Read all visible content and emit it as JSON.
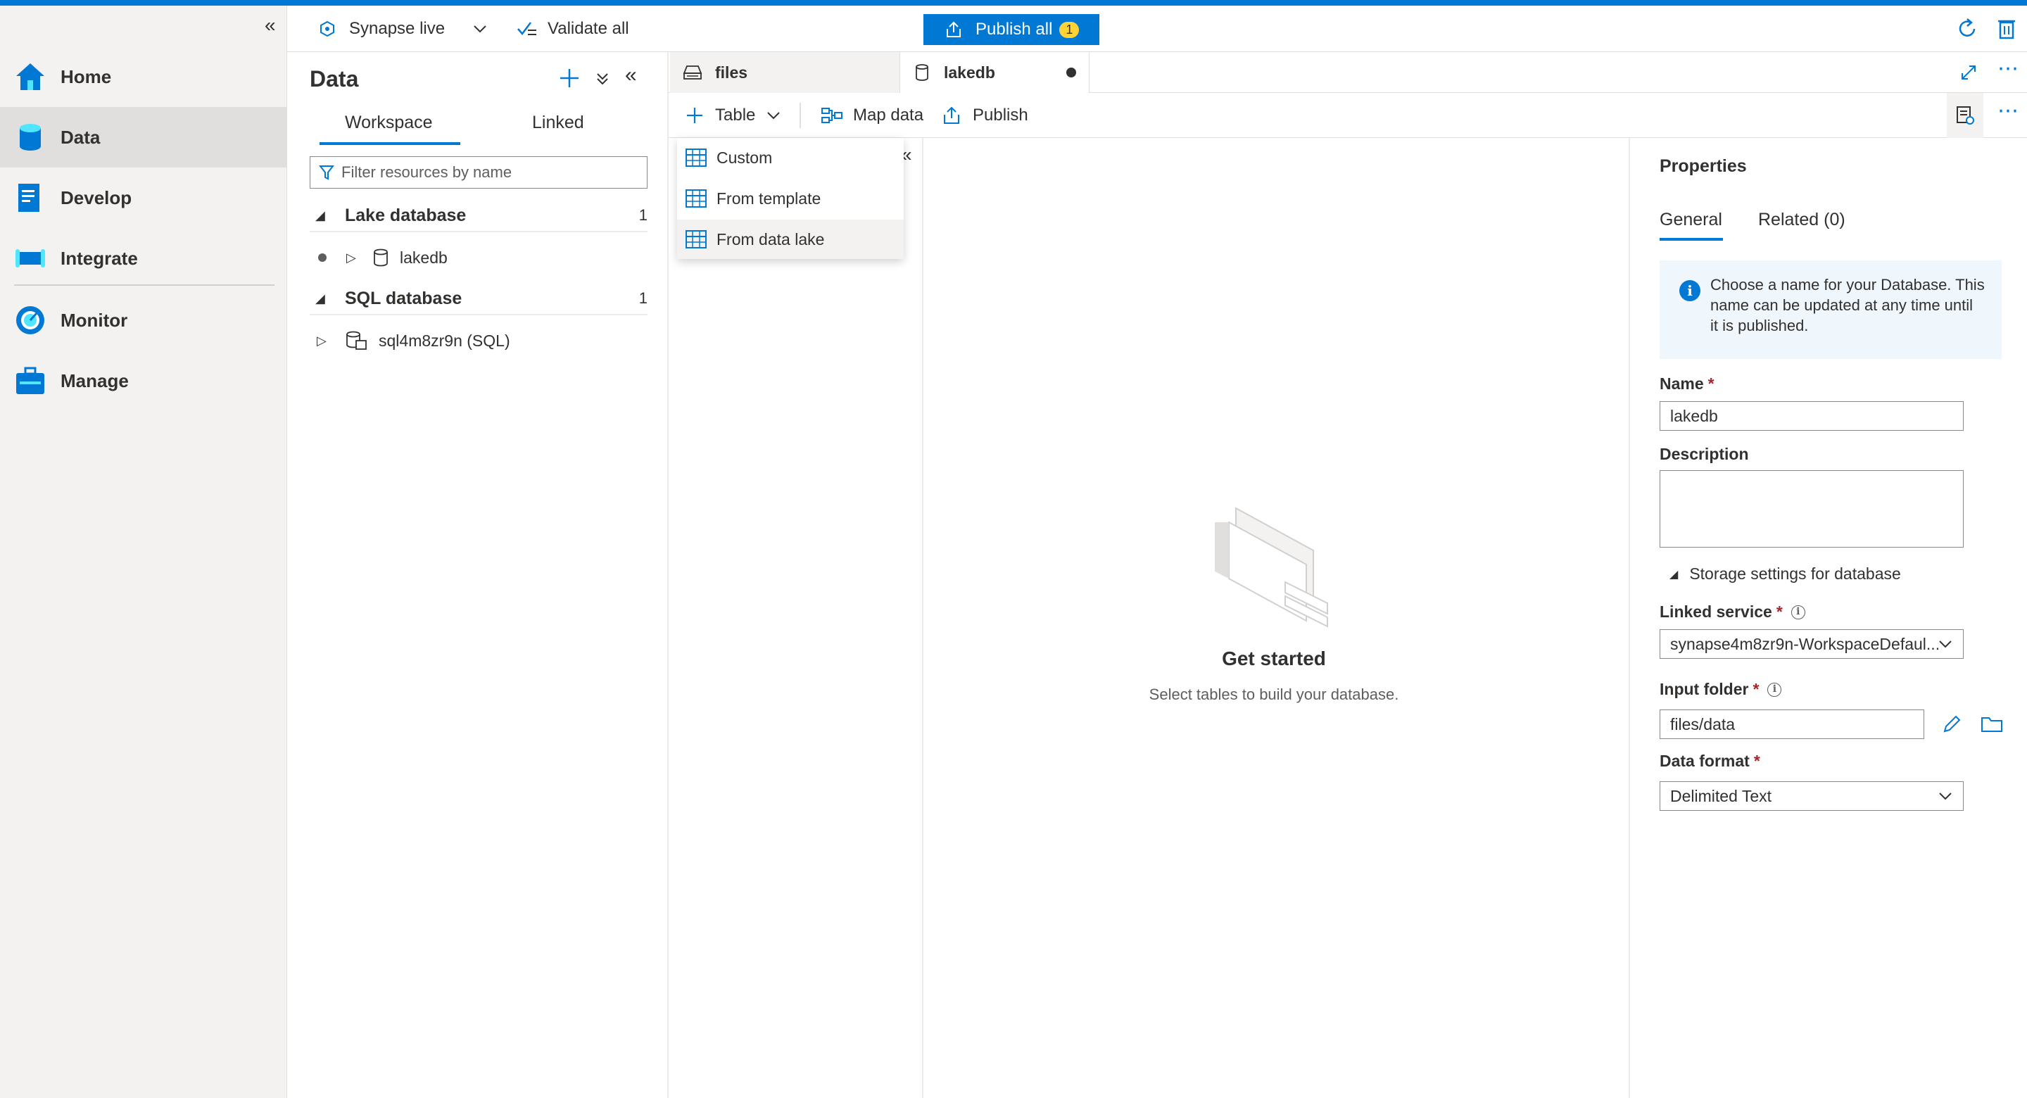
{
  "nav": {
    "items": [
      {
        "label": "Home",
        "icon": "home-icon"
      },
      {
        "label": "Data",
        "icon": "data-icon",
        "active": true
      },
      {
        "label": "Develop",
        "icon": "develop-icon"
      },
      {
        "label": "Integrate",
        "icon": "integrate-icon"
      },
      {
        "label": "Monitor",
        "icon": "monitor-icon"
      },
      {
        "label": "Manage",
        "icon": "manage-icon"
      }
    ]
  },
  "toolbar": {
    "mode_label": "Synapse live",
    "validate_label": "Validate all",
    "publish_label": "Publish all",
    "publish_count": "1"
  },
  "data_panel": {
    "title": "Data",
    "tabs": [
      "Workspace",
      "Linked"
    ],
    "active_tab": "Workspace",
    "filter_placeholder": "Filter resources by name",
    "sections": [
      {
        "label": "Lake database",
        "count": "1",
        "items": [
          "lakedb"
        ]
      },
      {
        "label": "SQL database",
        "count": "1",
        "items": [
          "sql4m8zr9n (SQL)"
        ]
      }
    ]
  },
  "editor": {
    "tabs": [
      {
        "label": "files"
      },
      {
        "label": "lakedb",
        "unsaved": true
      }
    ],
    "toolbar": {
      "table_label": "Table",
      "map_data_label": "Map data",
      "publish_label": "Publish"
    },
    "table_menu": [
      "Custom",
      "From template",
      "From data lake"
    ],
    "table_menu_highlighted": "From data lake",
    "empty_title": "Get started",
    "empty_subtitle": "Select tables to build your database."
  },
  "properties": {
    "title": "Properties",
    "tabs": [
      "General",
      "Related (0)"
    ],
    "active_tab": "General",
    "info_text": "Choose a name for your Database. This name can be updated at any time until it is published.",
    "name_label": "Name",
    "name_value": "lakedb",
    "description_label": "Description",
    "description_value": "",
    "storage_header": "Storage settings for database",
    "linked_service_label": "Linked service",
    "linked_service_value": "synapse4m8zr9n-WorkspaceDefaul...",
    "input_folder_label": "Input folder",
    "input_folder_value": "files/data",
    "data_format_label": "Data format",
    "data_format_value": "Delimited Text",
    "required_mark": "*"
  },
  "colors": {
    "accent": "#0078d4",
    "badge": "#ffd335",
    "required": "#a4262c",
    "nav_bg": "#f3f2f1"
  }
}
